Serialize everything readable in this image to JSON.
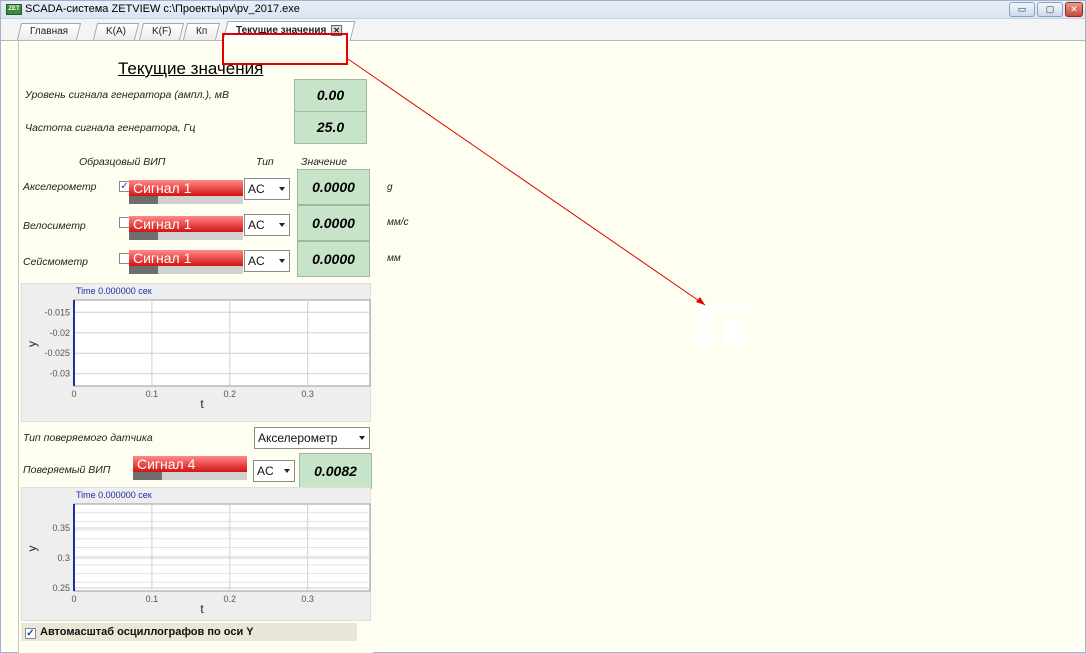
{
  "window": {
    "title": "SCADA-система ZETVIEW c:\\Проекты\\pv\\pv_2017.exe",
    "icon": "zetview-app-icon",
    "buttons": {
      "minimize": "▭",
      "maximize": "▢",
      "close": "✕"
    }
  },
  "tabs": [
    {
      "label": "Главная"
    },
    {
      "label": "K(A)"
    },
    {
      "label": "K(F)"
    },
    {
      "label": "Кп"
    },
    {
      "label": "Текущие значения",
      "active": true
    }
  ],
  "main": {
    "heading": "Текущие значения",
    "generator_level": {
      "label": "Уровень сигнала генератора (ампл.), мВ",
      "value": "0.00"
    },
    "generator_freq": {
      "label": "Частота сигнала генератора, Гц",
      "value": "25.0"
    },
    "table_headers": {
      "reference": "Образцовый ВИП",
      "type": "Тип",
      "value": "Значение"
    },
    "rows": [
      {
        "label": "Акселерометр",
        "checked": true,
        "checkmark": "✓",
        "signal": "Сигнал 1",
        "type": "AC",
        "value": "0.0000",
        "unit": "g",
        "level": 0.25
      },
      {
        "label": "Велосиметр",
        "checked": false,
        "checkmark": "",
        "signal": "Сигнал 1",
        "type": "AC",
        "value": "0.0000",
        "unit": "мм/с",
        "level": 0.25
      },
      {
        "label": "Сейсмометр",
        "checked": false,
        "checkmark": "",
        "signal": "Сигнал 1",
        "type": "AC",
        "value": "0.0000",
        "unit": "мм",
        "level": 0.25
      }
    ],
    "sensor_type": {
      "label": "Тип поверяемого датчика",
      "value": "Акселерометр"
    },
    "tested": {
      "label": "Поверяемый ВИП",
      "signal": "Сигнал 4",
      "type": "AC",
      "value": "0.0082",
      "level": 0.25
    },
    "autoscale": {
      "label": "Автомасштаб осциллографов по оси Y",
      "checked": true,
      "checkmark": "✓"
    }
  },
  "chart_data": [
    {
      "type": "line",
      "title": "Time 0.000000 сек",
      "xlabel": "t",
      "ylabel": "y",
      "xticks": [
        "0",
        "0.1",
        "0.2",
        "0.3"
      ],
      "yticks": [
        "-0.015",
        "-0.02",
        "-0.025",
        "-0.03"
      ],
      "xlim": [
        0,
        0.38
      ],
      "ylim": [
        -0.033,
        -0.012
      ],
      "grid": true,
      "series": [
        {
          "x": [
            0,
            0
          ],
          "y": [
            -0.033,
            -0.012
          ]
        }
      ]
    },
    {
      "type": "line",
      "title": "Time 0.000000 сек",
      "xlabel": "t",
      "ylabel": "y",
      "xticks": [
        "0",
        "0.1",
        "0.2",
        "0.3"
      ],
      "yticks": [
        "0.35",
        "0.3",
        "0.25"
      ],
      "xlim": [
        0,
        0.38
      ],
      "ylim": [
        0.245,
        0.39
      ],
      "grid": true,
      "series": [
        {
          "x": [
            0,
            0
          ],
          "y": [
            0.245,
            0.39
          ]
        }
      ]
    }
  ],
  "colors": {
    "value_box": "#c8e4c8",
    "signal_bar": "#d41212",
    "panel_bg": "#fefff0",
    "annotation": "#e00000",
    "plot_cursor": "#1a2fa8"
  }
}
